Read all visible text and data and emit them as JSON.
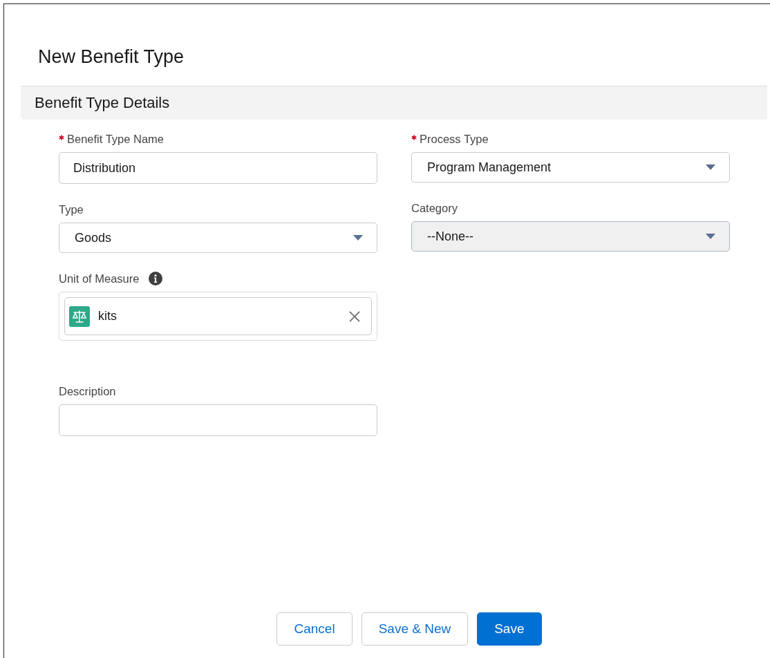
{
  "title": "New Benefit Type",
  "section": {
    "title": "Benefit Type Details"
  },
  "left_column": [
    {
      "kind": "text",
      "label": "Benefit Type Name",
      "required": true,
      "info": false,
      "disabled": false,
      "value": "Distribution"
    },
    {
      "kind": "select",
      "label": "Type",
      "required": false,
      "info": false,
      "disabled": false,
      "value": "Goods"
    },
    {
      "kind": "lookup",
      "label": "Unit of Measure",
      "required": false,
      "info": true,
      "disabled": false,
      "value": "kits"
    },
    {
      "kind": "text",
      "label": "Description",
      "required": false,
      "info": false,
      "disabled": false
    }
  ],
  "right_column": [
    {
      "kind": "select",
      "label": "Process Type",
      "required": true,
      "info": false,
      "disabled": false,
      "value": "Program Management"
    },
    {
      "kind": "select",
      "label": "Category",
      "required": false,
      "info": false,
      "disabled": true,
      "value": "--None--"
    }
  ],
  "buttons": [
    {
      "label": "Cancel",
      "kind": "neutral"
    },
    {
      "label": "Save & New",
      "kind": "neutral"
    },
    {
      "label": "Save",
      "kind": "brand"
    }
  ]
}
